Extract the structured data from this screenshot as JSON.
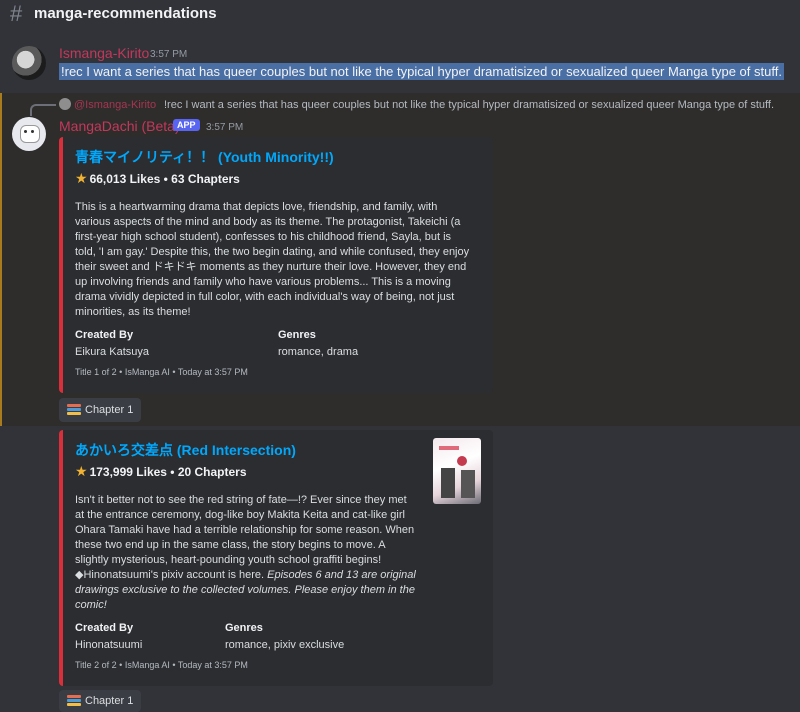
{
  "channel": {
    "name": "manga-recommendations"
  },
  "message1": {
    "author": "Ismanga-Kirito",
    "time": "3:57 PM",
    "text": "!rec I want a series that has queer couples but not like the typical hyper dramatisized or sexualized queer Manga type of stuff."
  },
  "reply": {
    "author": "@Ismanga-Kirito",
    "text": "!rec I want a series that has queer couples but not like the typical hyper dramatisized or sexualized queer Manga type of stuff."
  },
  "message2": {
    "author": "MangaDachi (Beta)",
    "badge": "APP",
    "time": "3:57 PM"
  },
  "embeds": [
    {
      "title": "青春マイノリティ！！ (Youth Minority!!)",
      "stats": "66,013 Likes • 63 Chapters",
      "desc_lines": [
        "This is a heartwarming drama that depicts love, friendship, and family, with",
        "various aspects of the mind and body as its theme. The protagonist, Takeichi (a",
        "first-year high school student), confesses to his childhood friend, Sayla, but is",
        "told, 'I am gay.' Despite this, the two begin dating, and while confused, they enjoy",
        "their sweet and ドキドキ moments as they nurture their love. However, they end",
        "up involving friends and family who have various problems... This is a moving",
        "drama vividly depicted in full color, with each individual's way of being, not just",
        "minorities, as its theme!"
      ],
      "created_by_label": "Created By",
      "created_by": "Eikura Katsuya",
      "genres_label": "Genres",
      "genres": "romance, drama",
      "footer": "Title 1 of 2 • IsManga AI • Today at 3:57 PM"
    },
    {
      "title": "あかいろ交差点 (Red Intersection)",
      "stats": "173,999 Likes • 20 Chapters",
      "desc_lines": [
        "Isn't it better not to see the red string of fate—!? Ever since they met",
        "at the entrance ceremony, dog-like boy Makita Keita and cat-like girl",
        "Ohara Tamaki have had a terrible relationship for some reason. When",
        "these two end up in the same class, the story begins to move. A",
        "slightly mysterious, heart-pounding youth school graffiti begins!"
      ],
      "desc_mixed_1": "◆Hinonatsuumi's pixiv account is here. ",
      "desc_mixed_2": "Episodes 6 and 13 are original",
      "desc_italic_lines": [
        "drawings exclusive to the collected volumes. Please enjoy them in the",
        "comic!"
      ],
      "created_by_label": "Created By",
      "created_by": "Hinonatsuumi",
      "genres_label": "Genres",
      "genres": "romance, pixiv exclusive",
      "footer": "Title 2 of 2 • IsManga AI • Today at 3:57 PM"
    }
  ],
  "chips": [
    {
      "label": "Chapter 1"
    },
    {
      "label": "Chapter 1"
    }
  ],
  "colors": {
    "author1": "#c3385b",
    "author2": "#c3385b",
    "link": "#00a8fc",
    "accent": "#d92f3a",
    "badge": "#5865f2"
  },
  "icons": [
    "hashtag-icon",
    "star-icon",
    "books-icon",
    "reply-arrow-icon"
  ]
}
